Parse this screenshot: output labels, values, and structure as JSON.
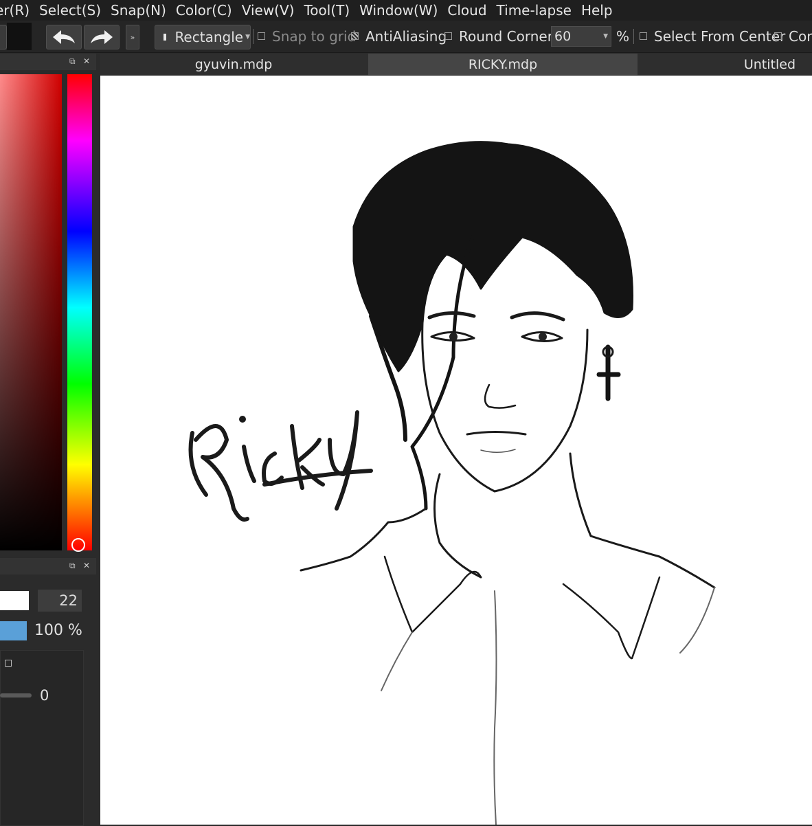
{
  "menu": [
    "er(R)",
    "Select(S)",
    "Snap(N)",
    "Color(C)",
    "View(V)",
    "Tool(T)",
    "Window(W)",
    "Cloud",
    "Time-lapse",
    "Help"
  ],
  "toolbar": {
    "shape_label": "Rectangle",
    "snap_to_grid": "Snap to grid",
    "antialiasing": "AntiAliasing",
    "round_corners": "Round Corners",
    "round_corners_value": "60",
    "percent": "%",
    "select_from_center": "Select From Center",
    "cont": "Con"
  },
  "tabs": [
    "gyuvin.mdp",
    "RICKY.mdp",
    "Untitled"
  ],
  "brush": {
    "size": "22",
    "opacity": "100 %",
    "blur": "0"
  },
  "canvas": {
    "signature_text": "Ricky"
  }
}
